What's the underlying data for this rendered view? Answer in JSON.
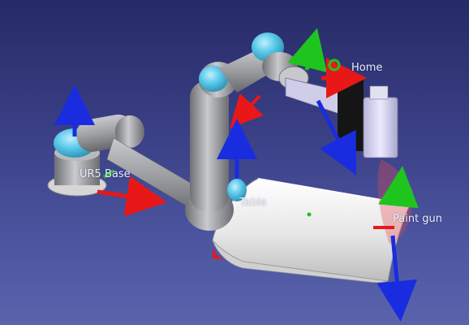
{
  "viewer": {
    "colors": {
      "background_top": "#262a66",
      "background_bottom": "#5a64ad",
      "robot_link": "#a9aaae",
      "robot_joint_cap": "#56c6e8",
      "table": "#f2f2f2",
      "axis_x": "#e81818",
      "axis_y": "#1fc41f",
      "axis_z": "#1a2ce0",
      "tool_body": "#d8d6f0"
    },
    "frames": [
      {
        "id": "home",
        "label": "Home"
      },
      {
        "id": "ur5_base",
        "label": "UR5 Base"
      },
      {
        "id": "table",
        "label": "Table"
      },
      {
        "id": "paint_gun",
        "label": "Paint gun"
      }
    ]
  }
}
